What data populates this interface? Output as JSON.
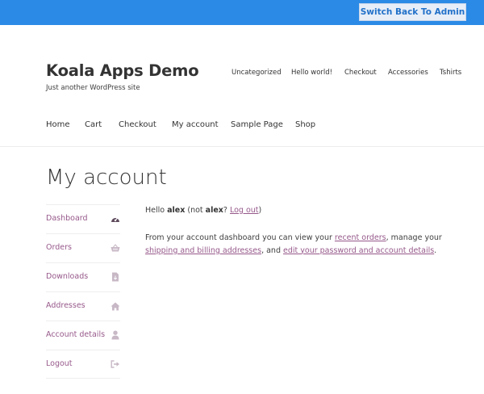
{
  "admin_bar": {
    "switch_label": "Switch Back To Admin"
  },
  "site": {
    "title": "Koala Apps Demo",
    "tagline": "Just another WordPress site"
  },
  "secondary_nav": [
    "Uncategorized",
    "Hello world!",
    "Checkout",
    "Accessories",
    "Tshirts"
  ],
  "primary_nav": [
    "Home",
    "Cart",
    "Checkout",
    "My account",
    "Sample Page",
    "Shop"
  ],
  "page": {
    "title": "My account"
  },
  "account_nav": [
    {
      "label": "Dashboard",
      "icon": "dashboard-gauge-icon",
      "active": true
    },
    {
      "label": "Orders",
      "icon": "basket-icon",
      "active": false
    },
    {
      "label": "Downloads",
      "icon": "file-download-icon",
      "active": false
    },
    {
      "label": "Addresses",
      "icon": "home-icon",
      "active": false
    },
    {
      "label": "Account details",
      "icon": "user-icon",
      "active": false
    },
    {
      "label": "Logout",
      "icon": "sign-out-icon",
      "active": false
    }
  ],
  "dashboard": {
    "hello_prefix": "Hello ",
    "username": "alex",
    "not_prefix": " (not ",
    "not_username": "alex",
    "question": "? ",
    "logout_link": "Log out",
    "close_paren": ")",
    "intro_1": "From your account dashboard you can view your ",
    "recent_orders_link": "recent orders",
    "intro_2": ", manage your ",
    "addresses_link": "shipping and billing addresses",
    "intro_3": ", and ",
    "account_link": "edit your password and account details",
    "intro_4": "."
  },
  "colors": {
    "admin_bar": "#2b8ae6",
    "link": "#96588a",
    "text": "#404040",
    "icon_inactive": "#c8b8c6",
    "icon_active": "#5e4a5c"
  }
}
